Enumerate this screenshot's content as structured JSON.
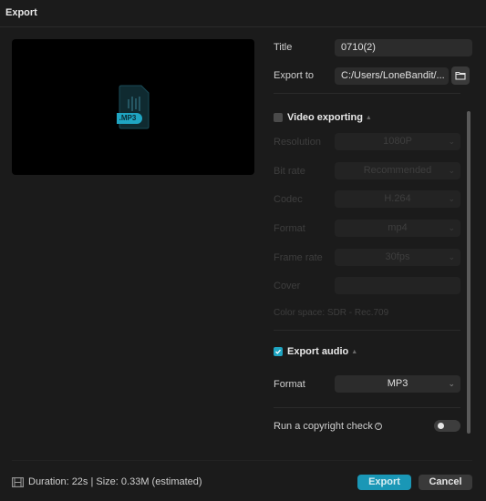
{
  "window": {
    "title": "Export"
  },
  "preview": {
    "file_badge": ".MP3",
    "icon": "audio-file-icon"
  },
  "form": {
    "title_label": "Title",
    "title_value": "0710(2)",
    "export_to_label": "Export to",
    "export_to_value": "C:/Users/LoneBandit/...",
    "folder_icon": "folder-icon"
  },
  "video": {
    "section_label": "Video exporting",
    "enabled": false,
    "resolution_label": "Resolution",
    "resolution_value": "1080P",
    "bitrate_label": "Bit rate",
    "bitrate_value": "Recommended",
    "codec_label": "Codec",
    "codec_value": "H.264",
    "format_label": "Format",
    "format_value": "mp4",
    "framerate_label": "Frame rate",
    "framerate_value": "30fps",
    "cover_label": "Cover",
    "cover_value": "",
    "color_space": "Color space: SDR - Rec.709"
  },
  "audio": {
    "section_label": "Export audio",
    "enabled": true,
    "format_label": "Format",
    "format_value": "MP3"
  },
  "copyright": {
    "label": "Run a copyright check",
    "enabled": false
  },
  "footer": {
    "status": "Duration: 22s | Size: 0.33M (estimated)",
    "export_label": "Export",
    "cancel_label": "Cancel"
  },
  "colors": {
    "accent": "#1a97b6",
    "checkbox_on": "#1fa5c2",
    "background": "#1b1b1b"
  }
}
